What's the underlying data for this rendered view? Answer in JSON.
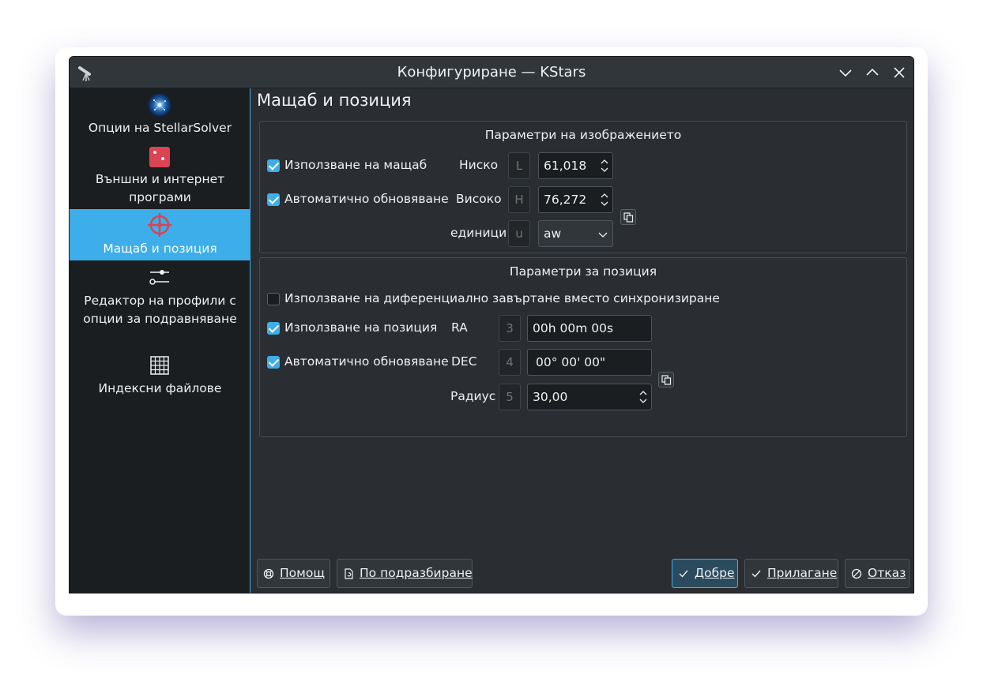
{
  "window": {
    "title": "Конфигуриране — KStars"
  },
  "sidebar": {
    "items": [
      {
        "label": "Опции на StellarSolver",
        "icon": "stellarsolver-icon"
      },
      {
        "label": "Външни и интернет програми",
        "icon": "external-programs-icon"
      },
      {
        "label": "Мащаб и позиция",
        "icon": "crosshair-icon",
        "active": true
      },
      {
        "label": "Редактор на профили с опции за подравняване",
        "icon": "sliders-icon"
      },
      {
        "label": "Индексни файлове",
        "icon": "grid-icon"
      }
    ]
  },
  "page": {
    "title": "Мащаб и позиция"
  },
  "image_params": {
    "title": "Параметри на изображението",
    "use_scale": {
      "label": "Използване на мащаб",
      "checked": true
    },
    "auto_update": {
      "label": "Автоматично обновяване",
      "checked": true
    },
    "low": {
      "label": "Ниско",
      "key": "L",
      "value": "61,018"
    },
    "high": {
      "label": "Високо",
      "key": "H",
      "value": "76,272"
    },
    "units": {
      "label": "единици",
      "key": "u",
      "value": "aw"
    }
  },
  "position_params": {
    "title": "Параметри за позиция",
    "differential": {
      "label": "Използване на диференциално завъртане вместо синхронизиране",
      "checked": false
    },
    "use_position": {
      "label": "Използване на позиция",
      "checked": true
    },
    "auto_update": {
      "label": "Автоматично обновяване",
      "checked": true
    },
    "ra": {
      "label": "RA",
      "key": "3",
      "value": "00h 00m 00s"
    },
    "dec": {
      "label": "DEC",
      "key": "4",
      "value": "00° 00' 00\""
    },
    "radius": {
      "label": "Радиус",
      "key": "5",
      "value": "30,00"
    }
  },
  "buttons": {
    "help": "Помощ",
    "defaults": "По подразбиране",
    "ok": "Добре",
    "apply": "Прилагане",
    "cancel": "Отказ"
  },
  "colors": {
    "accent": "#3daee9",
    "window_bg": "#2a2e32",
    "sidebar_bg": "#1b1e20",
    "active_crosshair": "#da4453"
  }
}
